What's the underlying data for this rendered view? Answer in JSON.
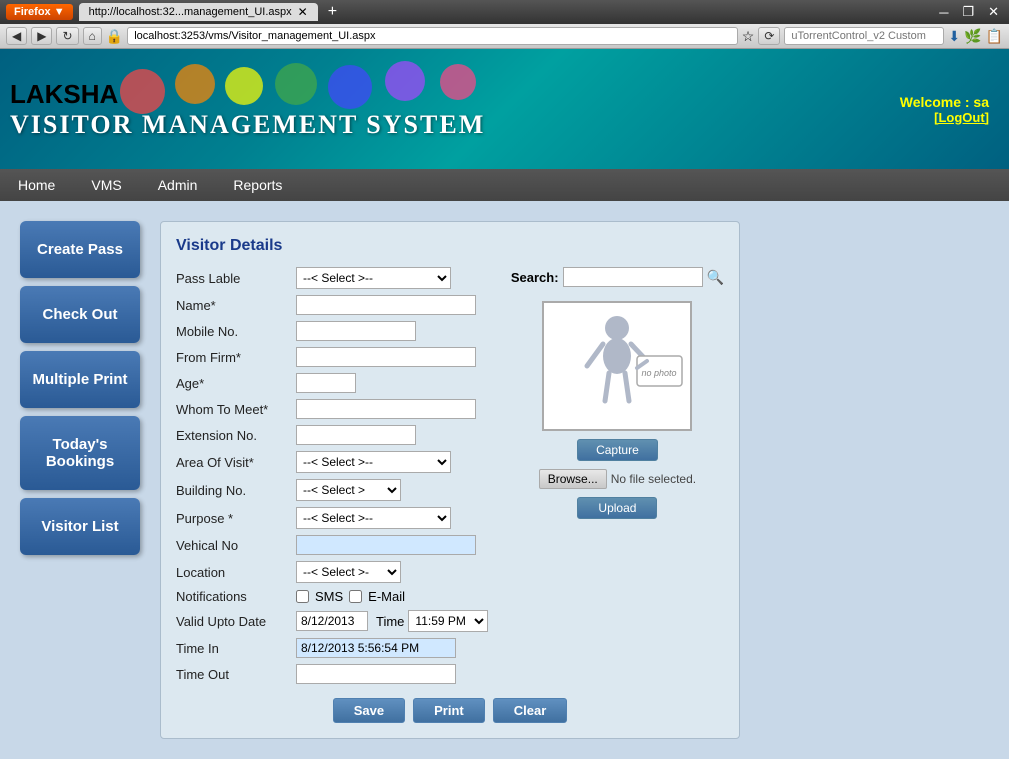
{
  "browser": {
    "tab_label": "http://localhost:32...management_UI.aspx",
    "address": "localhost:3253/vms/Visitor_management_UI.aspx",
    "search_placeholder": "uTorrentControl_v2 Custom"
  },
  "header": {
    "app_name": "LAKSHA",
    "system_name": "VISITOR MANAGEMENT SYSTEM",
    "welcome_text": "Welcome : sa",
    "logout_label": "[LogOut]"
  },
  "nav": {
    "items": [
      "Home",
      "VMS",
      "Admin",
      "Reports"
    ]
  },
  "sidebar": {
    "buttons": [
      {
        "id": "create-pass",
        "label": "Create Pass"
      },
      {
        "id": "check-out",
        "label": "Check Out"
      },
      {
        "id": "multiple-print",
        "label": "Multiple Print"
      },
      {
        "id": "todays-bookings",
        "label": "Today's Bookings"
      },
      {
        "id": "visitor-list",
        "label": "Visitor List"
      }
    ]
  },
  "form": {
    "title": "Visitor Details",
    "fields": {
      "pass_label": "Pass Lable",
      "name_label": "Name*",
      "mobile_label": "Mobile No.",
      "from_firm_label": "From Firm*",
      "age_label": "Age*",
      "whom_to_meet_label": "Whom To Meet*",
      "extension_label": "Extension No.",
      "area_of_visit_label": "Area Of Visit*",
      "building_no_label": "Building No.",
      "purpose_label": "Purpose *",
      "vehical_label": "Vehical No",
      "location_label": "Location",
      "notifications_label": "Notifications",
      "valid_upto_label": "Valid Upto Date",
      "time_in_label": "Time In",
      "time_out_label": "Time Out"
    },
    "select_default": "--< Select >--",
    "select_short": "--< Select >-",
    "sms_label": "SMS",
    "email_label": "E-Mail",
    "valid_date": "8/12/2013",
    "time_label": "Time",
    "time_value": "11:59 PM",
    "time_in_value": "8/12/2013 5:56:54 PM",
    "buttons": {
      "save": "Save",
      "print": "Print",
      "clear": "Clear"
    }
  },
  "photo_area": {
    "search_label": "Search:",
    "search_placeholder": "",
    "no_photo_text": "no photo",
    "capture_btn": "Capture",
    "browse_btn": "Browse...",
    "no_file_text": "No file selected.",
    "upload_btn": "Upload"
  }
}
